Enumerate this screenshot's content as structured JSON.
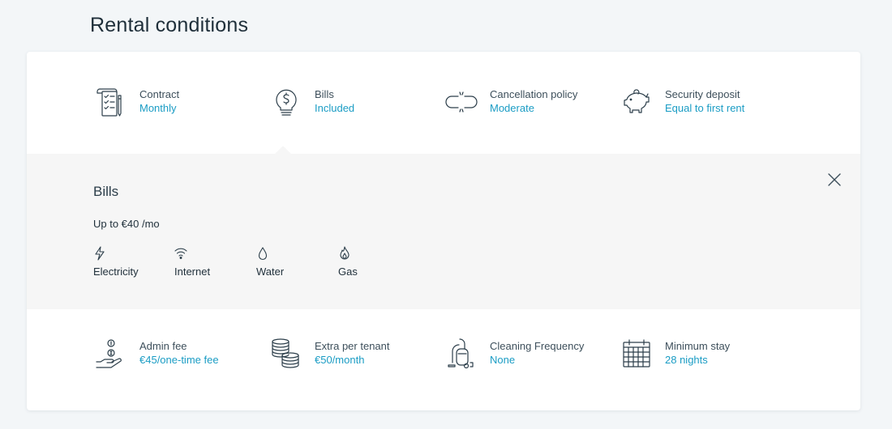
{
  "page": {
    "title": "Rental conditions"
  },
  "conditions_top": [
    {
      "label": "Contract",
      "value": "Monthly",
      "icon": "contract-icon"
    },
    {
      "label": "Bills",
      "value": "Included",
      "icon": "lightbulb-dollar-icon"
    },
    {
      "label": "Cancellation policy",
      "value": "Moderate",
      "icon": "broken-link-icon"
    },
    {
      "label": "Security deposit",
      "value": "Equal to first rent",
      "icon": "piggy-bank-icon"
    }
  ],
  "bills_panel": {
    "title": "Bills",
    "price": "Up to €40 /mo",
    "utilities": [
      {
        "label": "Electricity",
        "icon": "lightning-icon"
      },
      {
        "label": "Internet",
        "icon": "wifi-icon"
      },
      {
        "label": "Water",
        "icon": "water-drop-icon"
      },
      {
        "label": "Gas",
        "icon": "flame-icon"
      }
    ]
  },
  "conditions_bottom": [
    {
      "label": "Admin fee",
      "value": "€45/one-time fee",
      "icon": "hand-coin-icon"
    },
    {
      "label": "Extra per tenant",
      "value": "€50/month",
      "icon": "coin-stack-icon"
    },
    {
      "label": "Cleaning Frequency",
      "value": "None",
      "icon": "vacuum-icon"
    },
    {
      "label": "Minimum stay",
      "value": "28 nights",
      "icon": "calendar-icon"
    }
  ],
  "colors": {
    "accent": "#1a9cc4",
    "text": "#3d4f5b",
    "panel_bg": "#f6f6f6",
    "page_bg": "#f3f6f8"
  }
}
